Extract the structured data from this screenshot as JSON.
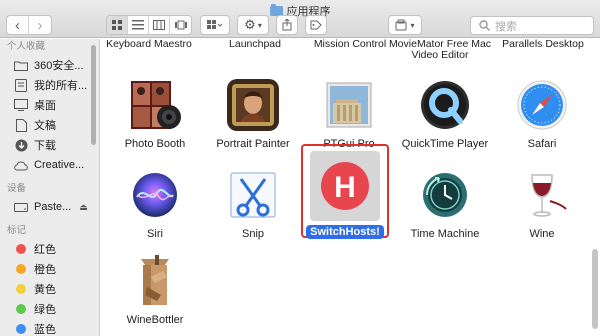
{
  "window": {
    "title": "应用程序"
  },
  "toolbar": {
    "back": "‹",
    "forward": "›",
    "search_placeholder": "搜索"
  },
  "sidebar": {
    "favorites_heading": "个人收藏",
    "favorites": [
      {
        "label": "360安全...",
        "icon": "folder-icon"
      },
      {
        "label": "我的所有...",
        "icon": "all-files-icon"
      },
      {
        "label": "桌面",
        "icon": "desktop-icon"
      },
      {
        "label": "文稿",
        "icon": "documents-icon"
      },
      {
        "label": "下载",
        "icon": "download-icon"
      },
      {
        "label": "Creative...",
        "icon": "creative-cloud-icon"
      }
    ],
    "devices_heading": "设备",
    "devices": [
      {
        "label": "Paste...",
        "icon": "disk-icon"
      }
    ],
    "tags_heading": "标记",
    "tags": [
      {
        "label": "红色",
        "color": "#f0524d"
      },
      {
        "label": "橙色",
        "color": "#f5a623"
      },
      {
        "label": "黄色",
        "color": "#f2d13b"
      },
      {
        "label": "绿色",
        "color": "#5bc94a"
      },
      {
        "label": "蓝色",
        "color": "#3a8ff2"
      }
    ]
  },
  "main": {
    "cut_labels": [
      "Keyboard Maestro",
      "Launchpad",
      "Mission Control",
      "MovieMator Free Mac Video Editor",
      "Parallels Desktop"
    ],
    "apps_row1": [
      {
        "label": "Photo Booth",
        "icon": "photo-booth-icon"
      },
      {
        "label": "Portrait Painter",
        "icon": "portrait-painter-icon"
      },
      {
        "label": "PTGui Pro",
        "icon": "ptgui-icon"
      },
      {
        "label": "QuickTime Player",
        "icon": "quicktime-icon"
      },
      {
        "label": "Safari",
        "icon": "safari-icon"
      }
    ],
    "apps_row2": [
      {
        "label": "Siri",
        "icon": "siri-icon"
      },
      {
        "label": "Snip",
        "icon": "snip-icon"
      },
      {
        "label": "SwitchHosts!",
        "icon": "switchhosts-icon",
        "selected": true
      },
      {
        "label": "Time Machine",
        "icon": "time-machine-icon"
      },
      {
        "label": "Wine",
        "icon": "wine-icon"
      }
    ],
    "apps_row3": [
      {
        "label": "WineBottler",
        "icon": "winebottler-icon"
      }
    ],
    "selection_color": "#2f6ee8",
    "highlight_color": "#e0302b"
  }
}
